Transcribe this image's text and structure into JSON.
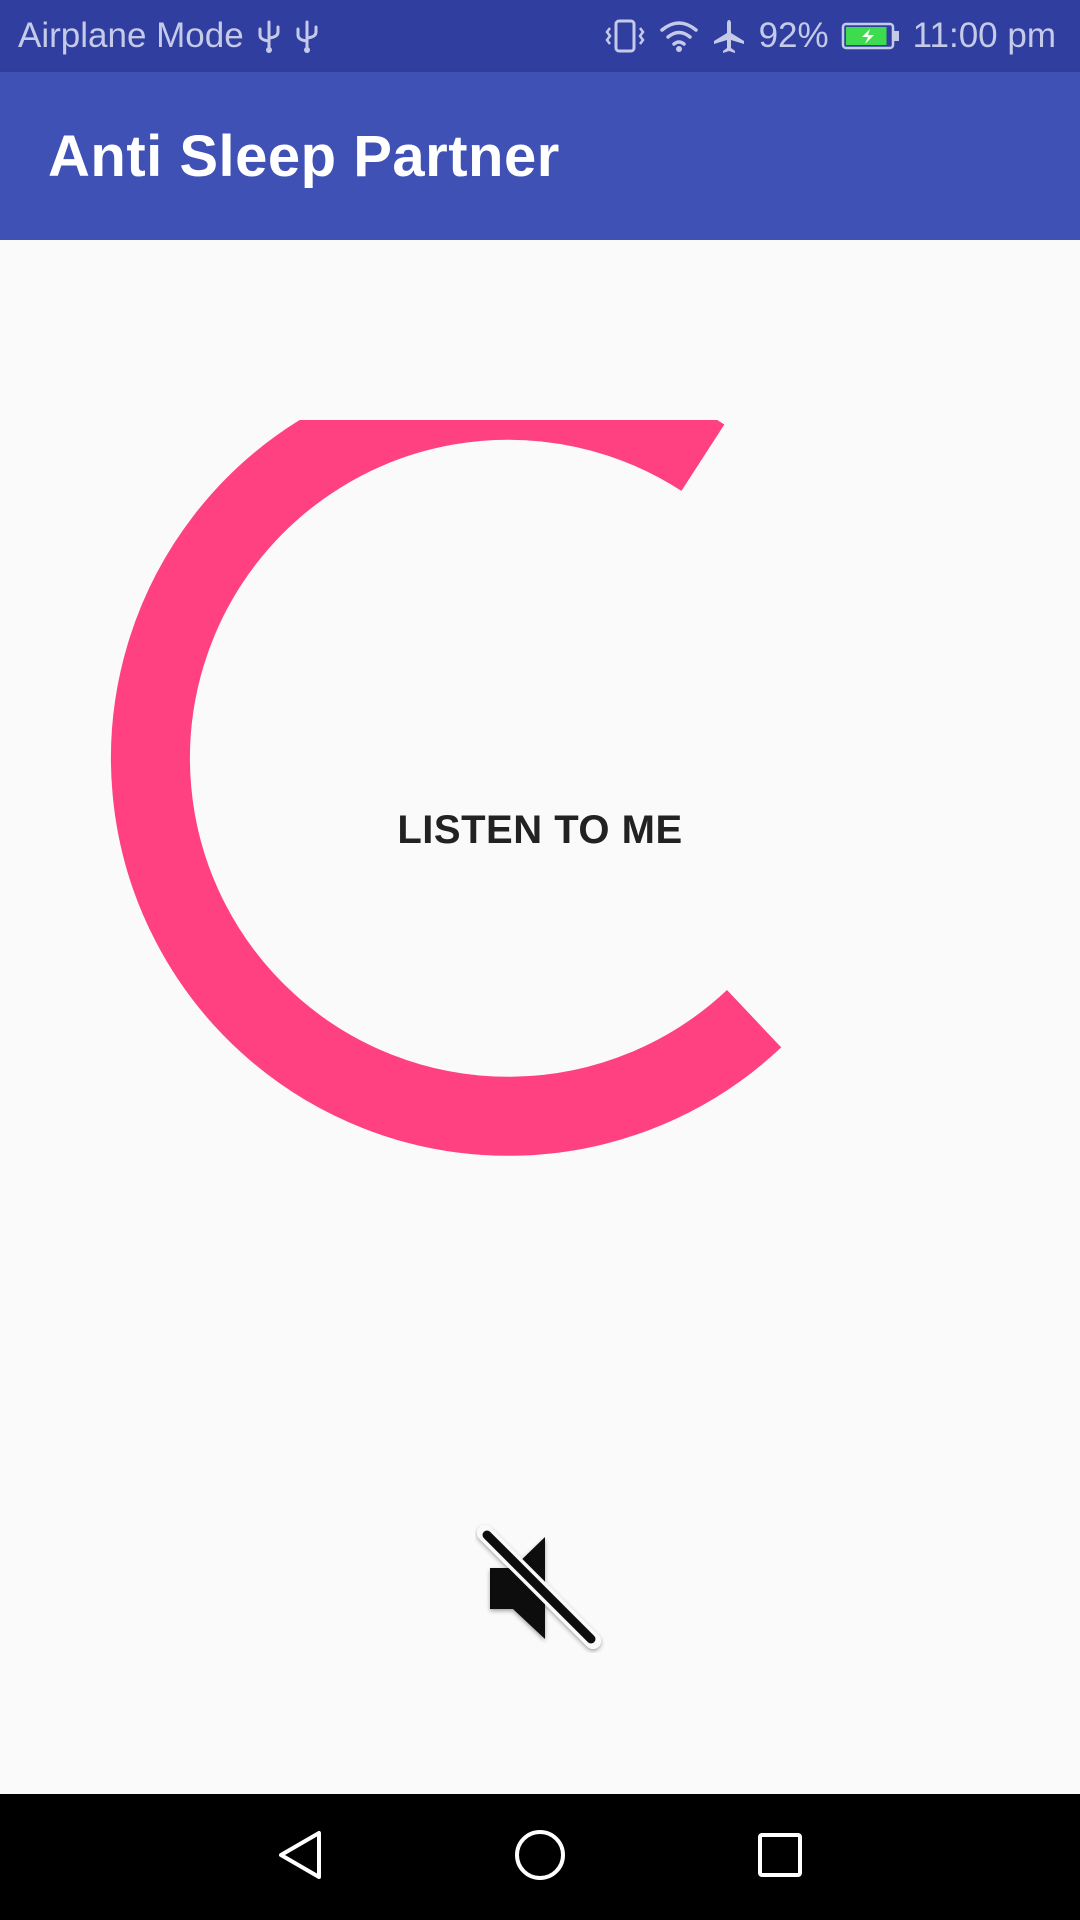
{
  "status_bar": {
    "left_text": "Airplane Mode",
    "battery_level": "92%",
    "time": "11:00 pm",
    "icons": [
      "usb-icon",
      "usb-icon",
      "vibrate-icon",
      "wifi-icon",
      "airplane-icon",
      "battery-charging-icon"
    ],
    "battery_fraction": 0.92
  },
  "app_bar": {
    "title": "Anti Sleep Partner"
  },
  "main": {
    "center_label": "LISTEN TO ME",
    "progress_ring_color": "#ff4081",
    "mute_icon": "volume-off-icon"
  },
  "colors": {
    "status_bar": "#303f9f",
    "app_bar": "#3f51b5",
    "accent": "#ff4081",
    "background": "#fafafa"
  },
  "nav_bar": {
    "icons": [
      "back-icon",
      "home-icon",
      "recents-icon"
    ]
  }
}
